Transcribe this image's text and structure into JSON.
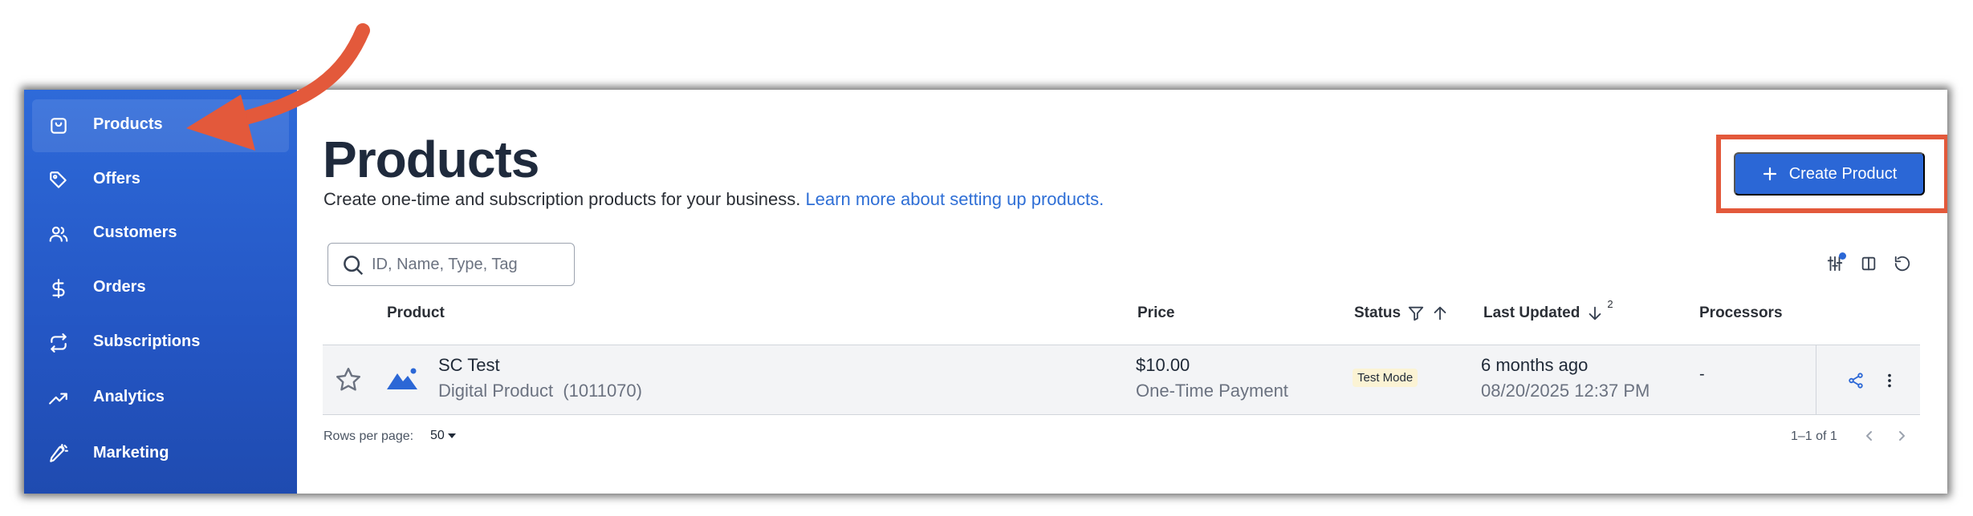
{
  "colors": {
    "sidebar": "#2e6ad9",
    "primary_button": "#2b67d6",
    "link": "#2f6fd6",
    "highlight": "#e3593b",
    "test_mode_badge": "#fbf3d4"
  },
  "sidebar": {
    "items": [
      {
        "label": "Products",
        "icon": "shopping-bag-icon",
        "active": true
      },
      {
        "label": "Offers",
        "icon": "tag-icon"
      },
      {
        "label": "Customers",
        "icon": "users-icon"
      },
      {
        "label": "Orders",
        "icon": "dollar-icon"
      },
      {
        "label": "Subscriptions",
        "icon": "repeat-icon"
      },
      {
        "label": "Analytics",
        "icon": "trending-up-icon"
      },
      {
        "label": "Marketing",
        "icon": "megaphone-icon"
      }
    ]
  },
  "header": {
    "title": "Products",
    "subtitle": "Create one-time and subscription products for your business.",
    "learn_more": "Learn more about setting up products.",
    "create_label": "Create Product"
  },
  "search": {
    "placeholder": "ID, Name, Type, Tag"
  },
  "table": {
    "columns": {
      "product": "Product",
      "price": "Price",
      "status": "Status",
      "last_updated": "Last Updated",
      "last_updated_sort_order": "2",
      "processors": "Processors"
    },
    "rows": [
      {
        "name": "SC Test",
        "type": "Digital Product",
        "id": "(1011070)",
        "price": "$10.00",
        "price_type": "One-Time Payment",
        "status": "Test Mode",
        "updated_relative": "6 months ago",
        "updated_date": "08/20/2025 12:37 PM",
        "processors": "-"
      }
    ]
  },
  "footer": {
    "rows_per_page_label": "Rows per page:",
    "rows_per_page_value": "50",
    "range": "1–1 of 1"
  }
}
